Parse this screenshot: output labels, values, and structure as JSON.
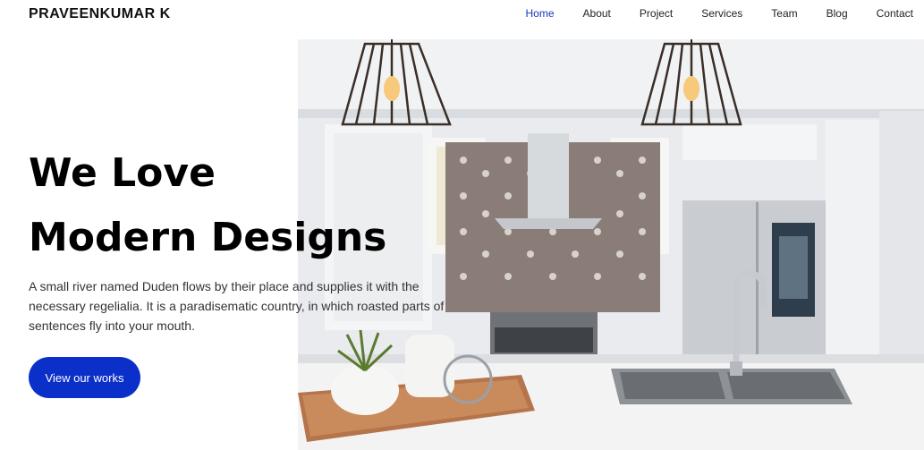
{
  "brand": "PRAVEENKUMAR K",
  "nav": [
    {
      "label": "Home"
    },
    {
      "label": "About"
    },
    {
      "label": "Project"
    },
    {
      "label": "Services"
    },
    {
      "label": "Team"
    },
    {
      "label": "Blog"
    },
    {
      "label": "Contact"
    }
  ],
  "hero": {
    "title_line1": "We Love",
    "title_line2": "Modern Designs",
    "description": "A small river named Duden flows by their place and supplies it with the necessary regelialia. It is a paradisematic country, in which roasted parts of sentences fly into your mouth.",
    "cta_label": "View our works"
  },
  "colors": {
    "accent": "#1a37b8",
    "button": "#0b2fc9"
  }
}
